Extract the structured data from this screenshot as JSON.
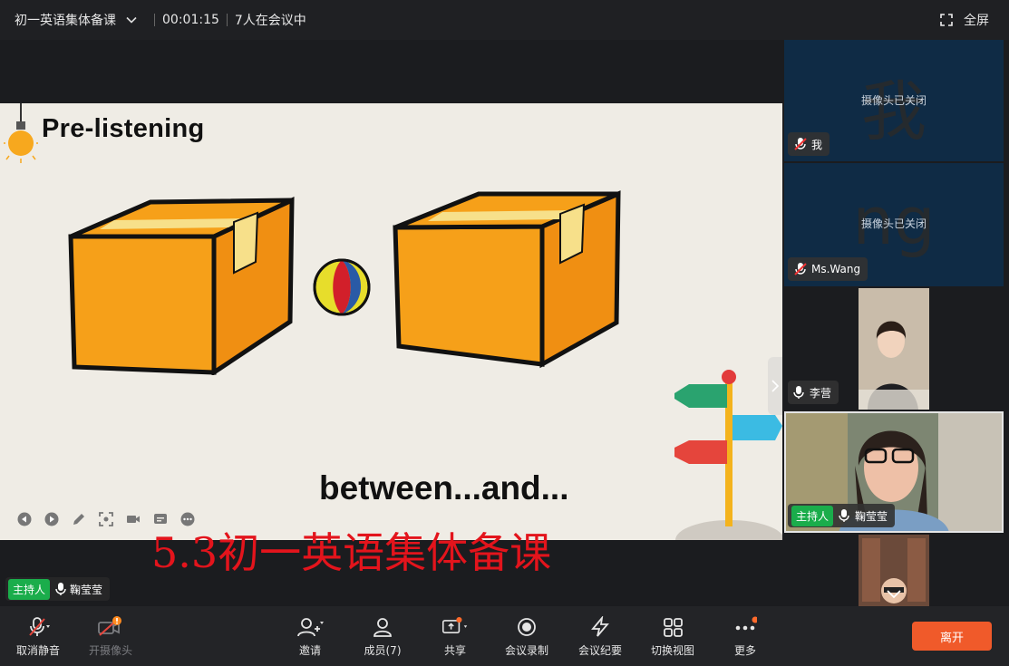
{
  "topbar": {
    "meeting_title": "初一英语集体备课",
    "elapsed": "00:01:15",
    "participants": "7人在会议中",
    "fullscreen_label": "全屏"
  },
  "slide": {
    "title": "Pre-listening",
    "caption": "between...and..."
  },
  "stage": {
    "watermark_text": "5.3初一英语集体备课",
    "host_badge": "主持人",
    "speaker_name": "鞠莹莹"
  },
  "participants": [
    {
      "avatar_text": "我",
      "status": "摄像头已关闭",
      "name": "我",
      "muted": true
    },
    {
      "avatar_text": "ng",
      "status": "摄像头已关闭",
      "name": "Ms.Wang",
      "muted": true
    },
    {
      "name": "李营",
      "muted": false
    },
    {
      "host_badge": "主持人",
      "name": "鞠莹莹",
      "muted": false
    },
    {
      "name": ""
    }
  ],
  "toolbar": {
    "unmute": "取消静音",
    "camera": "开摄像头",
    "invite": "邀请",
    "members": "成员(7)",
    "share": "共享",
    "record": "会议录制",
    "minutes": "会议纪要",
    "switch_view": "切换视图",
    "more": "更多",
    "leave": "离开"
  },
  "colors": {
    "accent_orange": "#f05a2a",
    "host_green": "#1aad4b",
    "watermark_red": "#e3141c",
    "camera_off_bg": "#0f2b45"
  }
}
